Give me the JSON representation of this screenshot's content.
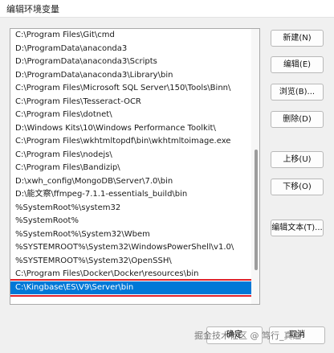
{
  "window": {
    "title": "编辑环境变量"
  },
  "paths": [
    "C:\\Program Files\\Git\\cmd",
    "D:\\ProgramData\\anaconda3",
    "D:\\ProgramData\\anaconda3\\Scripts",
    "D:\\ProgramData\\anaconda3\\Library\\bin",
    "C:\\Program Files\\Microsoft SQL Server\\150\\Tools\\Binn\\",
    "C:\\Program Files\\Tesseract-OCR",
    "C:\\Program Files\\dotnet\\",
    "D:\\Windows Kits\\10\\Windows Performance Toolkit\\",
    "C:\\Program Files\\wkhtmltopdf\\bin\\wkhtmltoimage.exe",
    "C:\\Program Files\\nodejs\\",
    "C:\\Program Files\\Bandizip\\",
    "D:\\xwh_config\\MongoDB\\Server\\7.0\\bin",
    "D:\\能文察\\ffmpeg-7.1.1-essentials_build\\bin",
    "%SystemRoot%\\system32",
    "%SystemRoot%",
    "%SystemRoot%\\System32\\Wbem",
    "%SYSTEMROOT%\\System32\\WindowsPowerShell\\v1.0\\",
    "%SYSTEMROOT%\\System32\\OpenSSH\\",
    "C:\\Program Files\\Docker\\Docker\\resources\\bin",
    "C:\\Kingbase\\ES\\V9\\Server\\bin"
  ],
  "selected_index": 19,
  "buttons": {
    "new": "新建(N)",
    "edit": "编辑(E)",
    "browse": "浏览(B)...",
    "delete": "删除(D)",
    "move_up": "上移(U)",
    "move_down": "下移(O)",
    "edit_text": "编辑文本(T)..."
  },
  "footer": {
    "ok": "确定",
    "cancel": "取消"
  },
  "watermark": "掘金技术社区 @ 笃行_真道",
  "colors": {
    "selection": "#0078d7",
    "highlight_border": "#e0222a"
  }
}
